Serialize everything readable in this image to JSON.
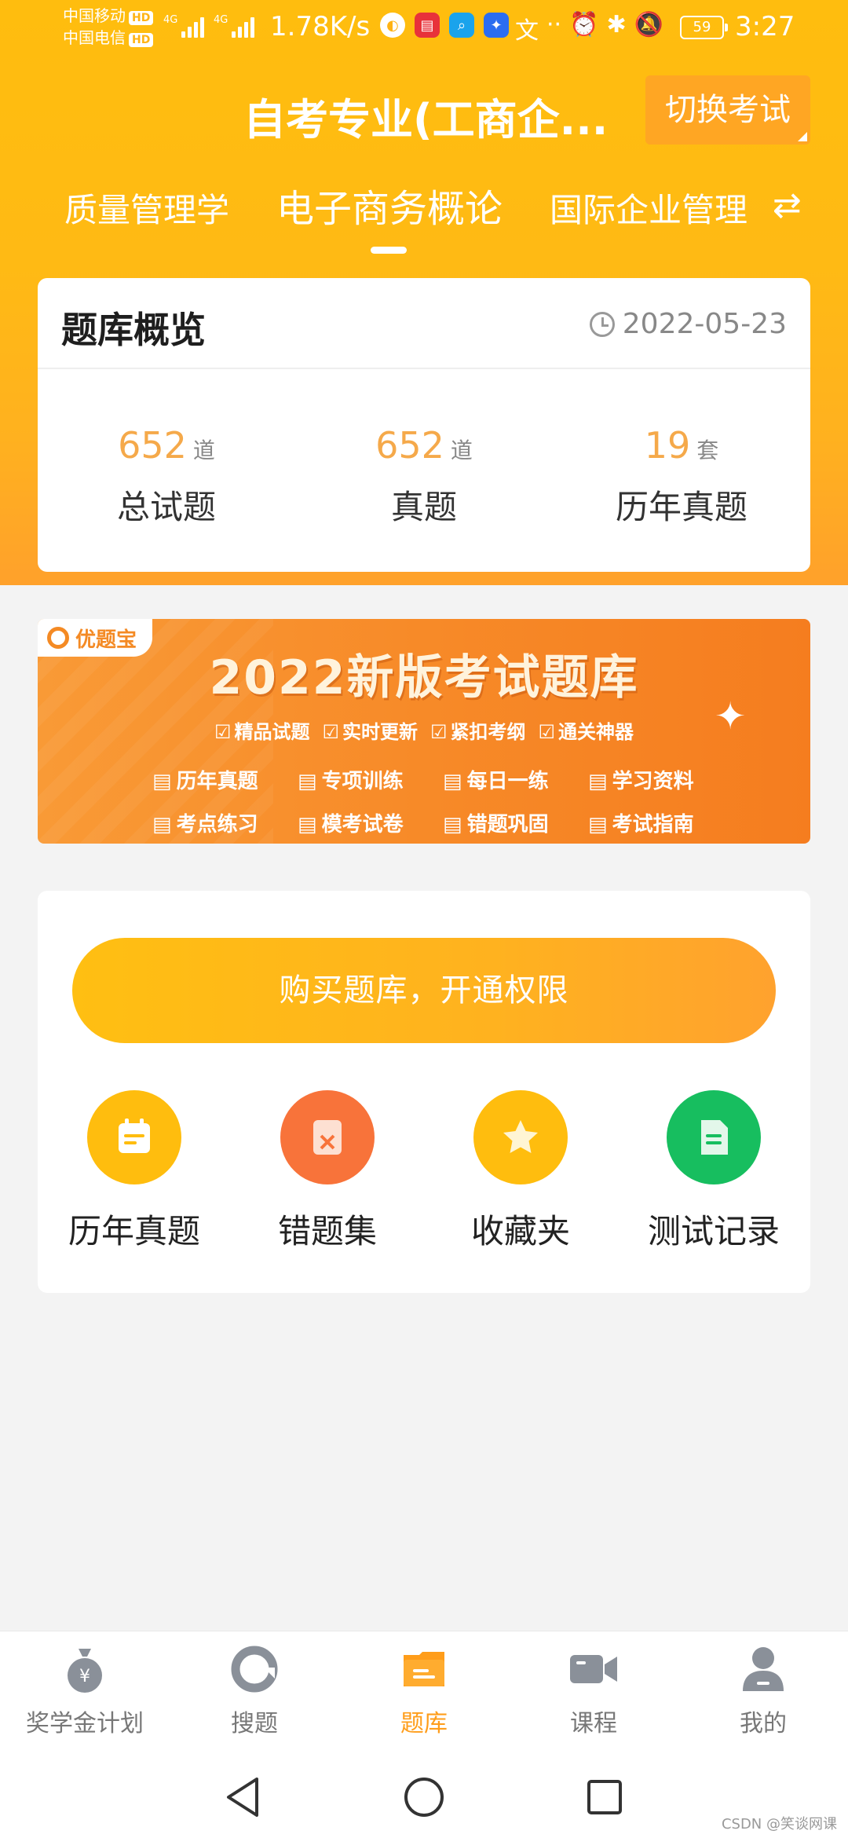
{
  "status_bar": {
    "carrier1": "中国移动",
    "carrier2": "中国电信",
    "hd": "HD",
    "network1": "4G",
    "network2": "4G",
    "speed": "1.78K/s",
    "battery": "59",
    "time": "3:27"
  },
  "header": {
    "title": "自考专业(工商企...",
    "switch_label": "切换考试"
  },
  "tabs": [
    {
      "label": "质量管理学",
      "active": false
    },
    {
      "label": "电子商务概论",
      "active": true
    },
    {
      "label": "国际企业管理",
      "active": false
    }
  ],
  "overview": {
    "title": "题库概览",
    "date": "2022-05-23",
    "stats": [
      {
        "value": "652",
        "unit": "道",
        "label": "总试题"
      },
      {
        "value": "652",
        "unit": "道",
        "label": "真题"
      },
      {
        "value": "19",
        "unit": "套",
        "label": "历年真题"
      }
    ]
  },
  "banner": {
    "badge": "优题宝",
    "title": "2022新版考试题库",
    "features": [
      "精品试题",
      "实时更新",
      "紧扣考纲",
      "通关神器"
    ],
    "items": [
      "历年真题",
      "专项训练",
      "每日一练",
      "学习资料",
      "考点练习",
      "模考试卷",
      "错题巩固",
      "考试指南"
    ]
  },
  "actions": {
    "buy_label": "购买题库，开通权限",
    "quick": [
      {
        "label": "历年真题",
        "icon": "calendar-icon",
        "color": "#ffbd0e"
      },
      {
        "label": "错题集",
        "icon": "wrong-answer-icon",
        "color": "#f8733a"
      },
      {
        "label": "收藏夹",
        "icon": "star-icon",
        "color": "#ffbd0e"
      },
      {
        "label": "测试记录",
        "icon": "document-icon",
        "color": "#17be5f"
      }
    ]
  },
  "bottom_nav": [
    {
      "label": "奖学金计划",
      "icon": "money-bag-icon",
      "active": false
    },
    {
      "label": "搜题",
      "icon": "search-icon",
      "active": false
    },
    {
      "label": "题库",
      "icon": "question-bank-icon",
      "active": true
    },
    {
      "label": "课程",
      "icon": "video-camera-icon",
      "active": false
    },
    {
      "label": "我的",
      "icon": "user-icon",
      "active": false
    }
  ],
  "watermark": "CSDN @笑谈网课",
  "colors": {
    "accent": "#ffbd0e",
    "active_nav": "#ff9d1a",
    "stat_number": "#f5a94a"
  }
}
